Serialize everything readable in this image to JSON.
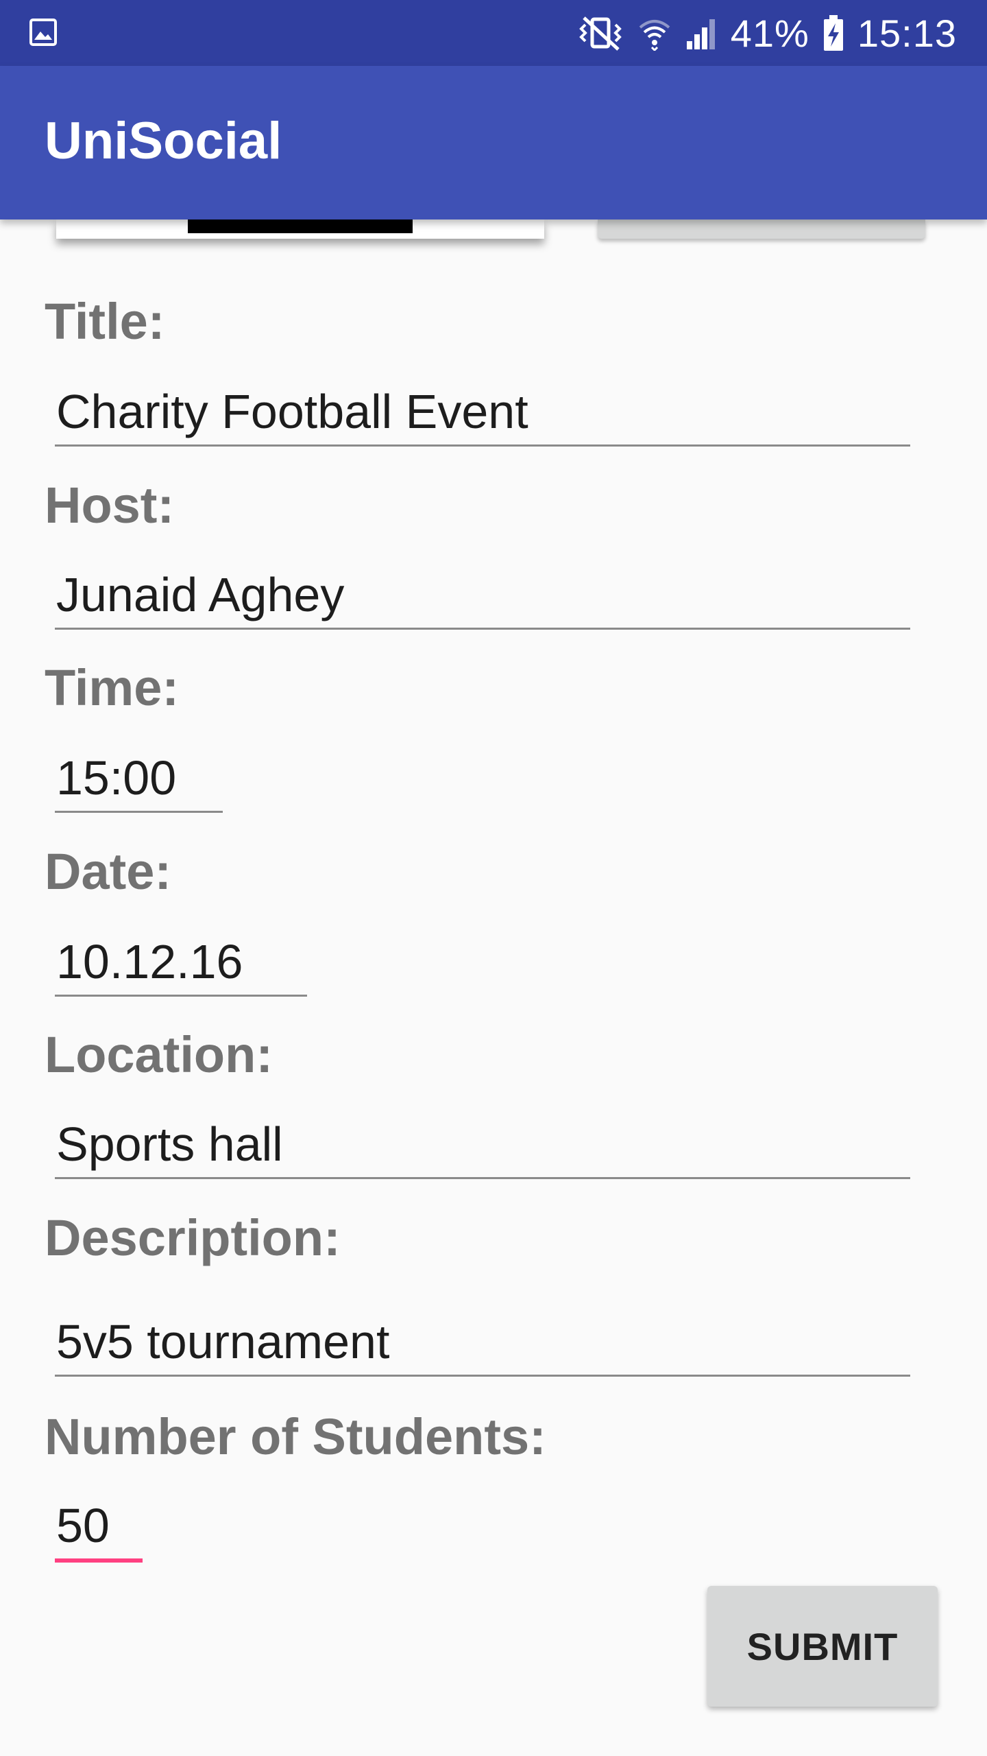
{
  "status_bar": {
    "icons": [
      "gallery-icon",
      "vibrate-mute-icon",
      "wifi-icon",
      "cell-signal-icon",
      "battery-charging-icon"
    ],
    "battery_percent": "41%",
    "time": "15:13"
  },
  "app_bar": {
    "title": "UniSocial"
  },
  "form": {
    "title": {
      "label": "Title:",
      "value": "Charity Football Event"
    },
    "host": {
      "label": "Host:",
      "value": "Junaid Aghey"
    },
    "time": {
      "label": "Time:",
      "value": "15:00"
    },
    "date": {
      "label": "Date:",
      "value": "10.12.16"
    },
    "location": {
      "label": "Location:",
      "value": "Sports hall"
    },
    "description": {
      "label": "Description:",
      "value": "5v5 tournament"
    },
    "students": {
      "label": "Number of Students:",
      "value": "50"
    }
  },
  "actions": {
    "submit_label": "SUBMIT"
  },
  "colors": {
    "status_bar": "#303f9f",
    "app_bar": "#3f51b5",
    "accent": "#ff4081",
    "label": "#727272"
  }
}
